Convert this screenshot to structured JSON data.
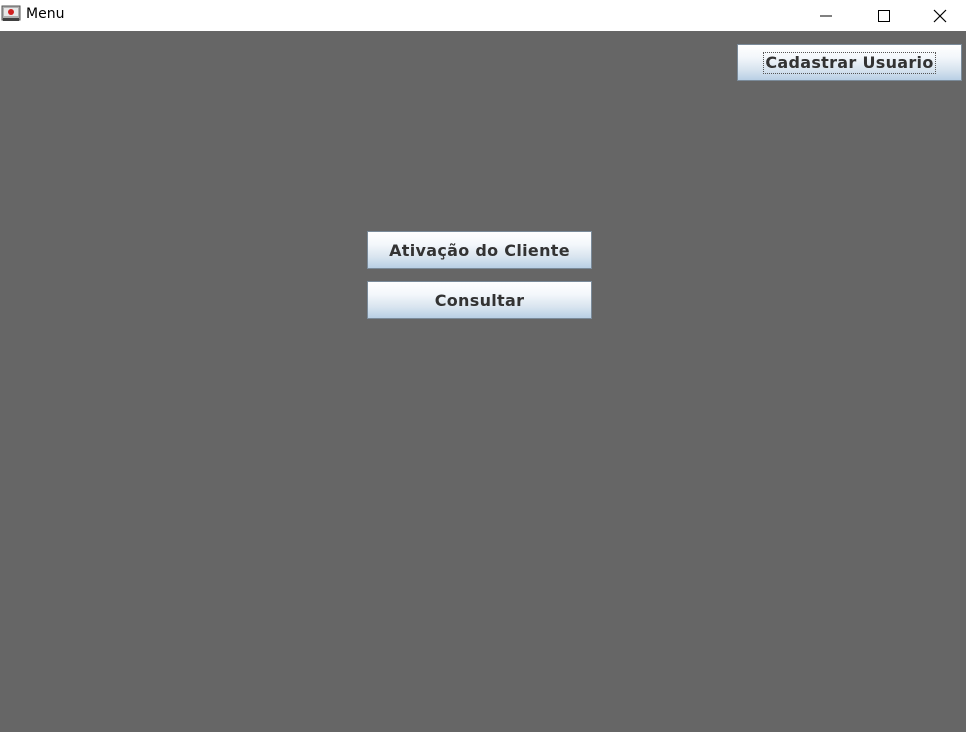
{
  "window": {
    "title": "Menu",
    "controls": {
      "minimize_icon": "minimize-icon",
      "maximize_icon": "maximize-icon",
      "close_icon": "close-icon"
    }
  },
  "colors": {
    "background": "#666666",
    "titlebar": "#ffffff",
    "button_text": "#333333"
  },
  "buttons": {
    "cadastrar_usuario": "Cadastrar Usuario",
    "ativacao_cliente": "Ativação do Cliente",
    "consultar": "Consultar"
  }
}
